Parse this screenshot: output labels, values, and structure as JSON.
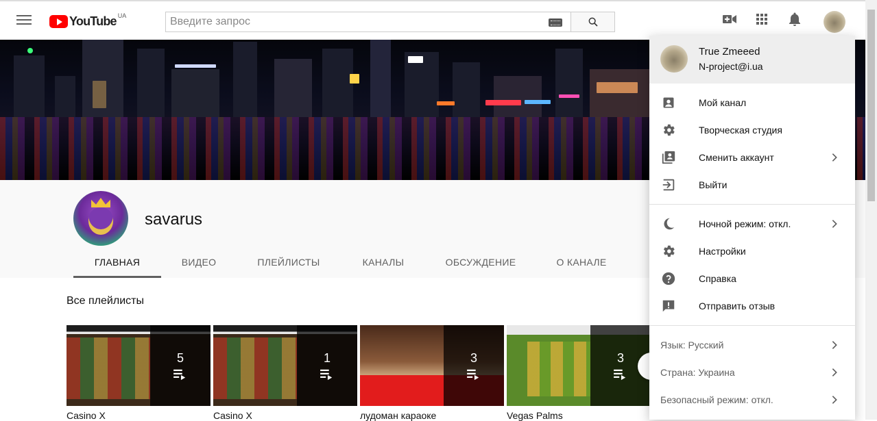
{
  "header": {
    "logo_text": "YouTube",
    "logo_region": "UA",
    "search_placeholder": "Введите запрос"
  },
  "channel": {
    "name": "savarus",
    "tabs": [
      {
        "label": "ГЛАВНАЯ",
        "active": true
      },
      {
        "label": "ВИДЕО",
        "active": false
      },
      {
        "label": "ПЛЕЙЛИСТЫ",
        "active": false
      },
      {
        "label": "КАНАЛЫ",
        "active": false
      },
      {
        "label": "ОБСУЖДЕНИЕ",
        "active": false
      },
      {
        "label": "О КАНАЛЕ",
        "active": false
      }
    ],
    "section_title": "Все плейлисты",
    "playlists": [
      {
        "title": "Casino X",
        "count": "5"
      },
      {
        "title": "Casino X",
        "count": "1"
      },
      {
        "title": "лудоман караоке",
        "count": "3"
      },
      {
        "title": "Vegas Palms",
        "count": "3"
      }
    ]
  },
  "account_menu": {
    "user_name": "True Zmeeed",
    "user_email": "N-project@i.ua",
    "items": [
      {
        "label": "Мой канал",
        "icon": "account-box-icon"
      },
      {
        "label": "Творческая студия",
        "icon": "gear-icon"
      },
      {
        "label": "Сменить аккаунт",
        "icon": "switch-account-icon"
      },
      {
        "label": "Выйти",
        "icon": "sign-out-icon"
      }
    ],
    "settings_items": [
      {
        "label": "Ночной режим: откл.",
        "icon": "moon-icon"
      },
      {
        "label": "Настройки",
        "icon": "gear-icon"
      },
      {
        "label": "Справка",
        "icon": "help-icon"
      },
      {
        "label": "Отправить отзыв",
        "icon": "feedback-icon"
      }
    ],
    "footer_items": [
      {
        "label": "Язык: Русский"
      },
      {
        "label": "Страна: Украина"
      },
      {
        "label": "Безопасный режим: откл."
      }
    ]
  },
  "colors": {
    "brand_red": "#ff0000",
    "icon_gray": "#606060",
    "menu_header_bg": "#eeeeee"
  }
}
